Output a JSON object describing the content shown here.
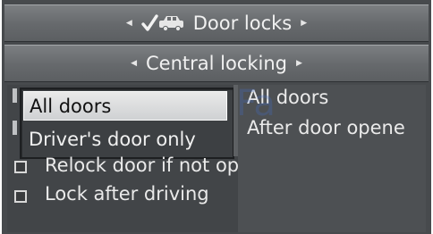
{
  "header": {
    "title": "Door locks",
    "subtitle": "Central locking"
  },
  "dropdown": {
    "selected": "All doors",
    "option": "Driver's door only"
  },
  "options_list": {
    "item1": "All doors",
    "item2": "After door opene"
  },
  "checkboxes": [
    {
      "label": "Relock door if not opened",
      "checked": false
    },
    {
      "label": "Lock after driving",
      "checked": false
    }
  ],
  "watermark": "Fa",
  "icons": {
    "row_arrows": "triangle-left/right",
    "door_lock": "check-car-icon"
  }
}
